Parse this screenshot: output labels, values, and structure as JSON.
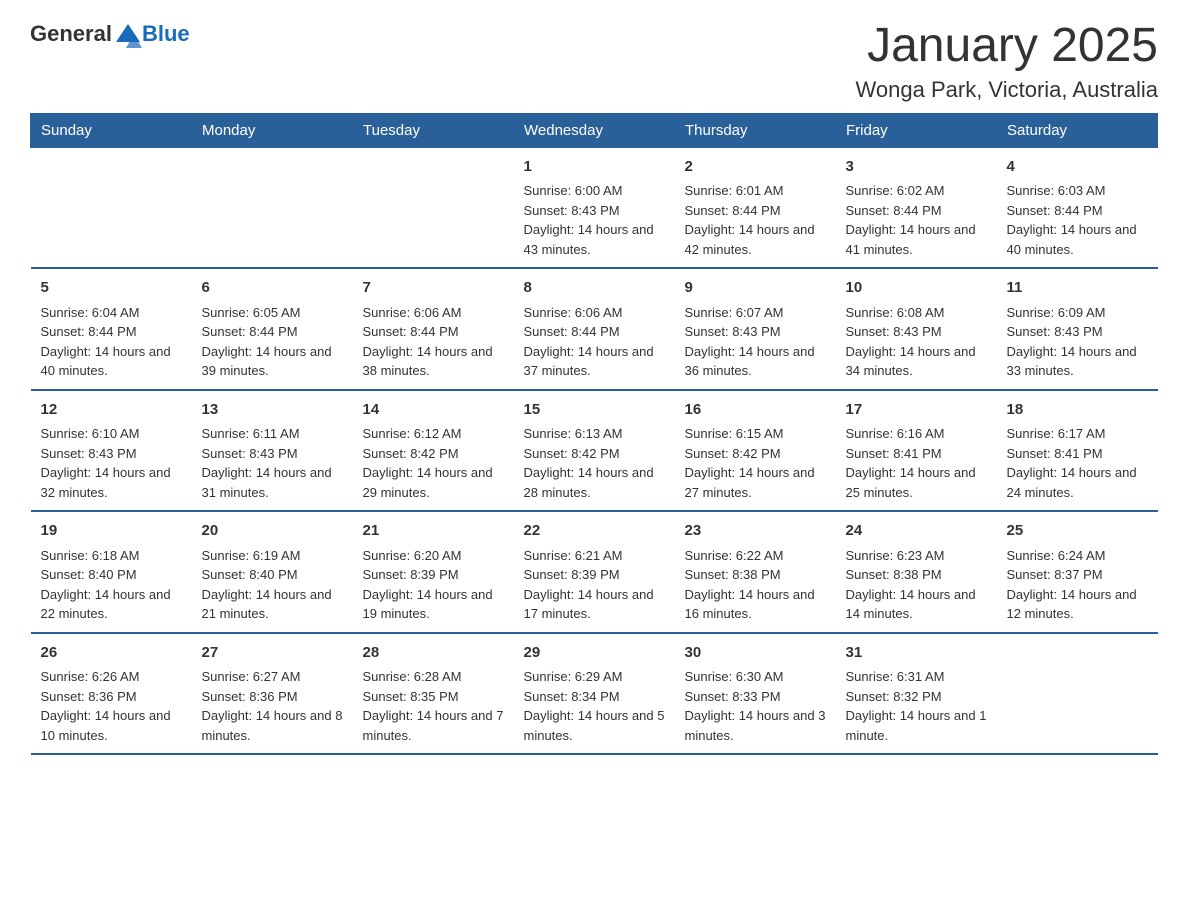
{
  "header": {
    "logo_general": "General",
    "logo_blue": "Blue",
    "month_title": "January 2025",
    "location": "Wonga Park, Victoria, Australia"
  },
  "days_of_week": [
    "Sunday",
    "Monday",
    "Tuesday",
    "Wednesday",
    "Thursday",
    "Friday",
    "Saturday"
  ],
  "weeks": [
    [
      {
        "day": "",
        "info": ""
      },
      {
        "day": "",
        "info": ""
      },
      {
        "day": "",
        "info": ""
      },
      {
        "day": "1",
        "info": "Sunrise: 6:00 AM\nSunset: 8:43 PM\nDaylight: 14 hours and 43 minutes."
      },
      {
        "day": "2",
        "info": "Sunrise: 6:01 AM\nSunset: 8:44 PM\nDaylight: 14 hours and 42 minutes."
      },
      {
        "day": "3",
        "info": "Sunrise: 6:02 AM\nSunset: 8:44 PM\nDaylight: 14 hours and 41 minutes."
      },
      {
        "day": "4",
        "info": "Sunrise: 6:03 AM\nSunset: 8:44 PM\nDaylight: 14 hours and 40 minutes."
      }
    ],
    [
      {
        "day": "5",
        "info": "Sunrise: 6:04 AM\nSunset: 8:44 PM\nDaylight: 14 hours and 40 minutes."
      },
      {
        "day": "6",
        "info": "Sunrise: 6:05 AM\nSunset: 8:44 PM\nDaylight: 14 hours and 39 minutes."
      },
      {
        "day": "7",
        "info": "Sunrise: 6:06 AM\nSunset: 8:44 PM\nDaylight: 14 hours and 38 minutes."
      },
      {
        "day": "8",
        "info": "Sunrise: 6:06 AM\nSunset: 8:44 PM\nDaylight: 14 hours and 37 minutes."
      },
      {
        "day": "9",
        "info": "Sunrise: 6:07 AM\nSunset: 8:43 PM\nDaylight: 14 hours and 36 minutes."
      },
      {
        "day": "10",
        "info": "Sunrise: 6:08 AM\nSunset: 8:43 PM\nDaylight: 14 hours and 34 minutes."
      },
      {
        "day": "11",
        "info": "Sunrise: 6:09 AM\nSunset: 8:43 PM\nDaylight: 14 hours and 33 minutes."
      }
    ],
    [
      {
        "day": "12",
        "info": "Sunrise: 6:10 AM\nSunset: 8:43 PM\nDaylight: 14 hours and 32 minutes."
      },
      {
        "day": "13",
        "info": "Sunrise: 6:11 AM\nSunset: 8:43 PM\nDaylight: 14 hours and 31 minutes."
      },
      {
        "day": "14",
        "info": "Sunrise: 6:12 AM\nSunset: 8:42 PM\nDaylight: 14 hours and 29 minutes."
      },
      {
        "day": "15",
        "info": "Sunrise: 6:13 AM\nSunset: 8:42 PM\nDaylight: 14 hours and 28 minutes."
      },
      {
        "day": "16",
        "info": "Sunrise: 6:15 AM\nSunset: 8:42 PM\nDaylight: 14 hours and 27 minutes."
      },
      {
        "day": "17",
        "info": "Sunrise: 6:16 AM\nSunset: 8:41 PM\nDaylight: 14 hours and 25 minutes."
      },
      {
        "day": "18",
        "info": "Sunrise: 6:17 AM\nSunset: 8:41 PM\nDaylight: 14 hours and 24 minutes."
      }
    ],
    [
      {
        "day": "19",
        "info": "Sunrise: 6:18 AM\nSunset: 8:40 PM\nDaylight: 14 hours and 22 minutes."
      },
      {
        "day": "20",
        "info": "Sunrise: 6:19 AM\nSunset: 8:40 PM\nDaylight: 14 hours and 21 minutes."
      },
      {
        "day": "21",
        "info": "Sunrise: 6:20 AM\nSunset: 8:39 PM\nDaylight: 14 hours and 19 minutes."
      },
      {
        "day": "22",
        "info": "Sunrise: 6:21 AM\nSunset: 8:39 PM\nDaylight: 14 hours and 17 minutes."
      },
      {
        "day": "23",
        "info": "Sunrise: 6:22 AM\nSunset: 8:38 PM\nDaylight: 14 hours and 16 minutes."
      },
      {
        "day": "24",
        "info": "Sunrise: 6:23 AM\nSunset: 8:38 PM\nDaylight: 14 hours and 14 minutes."
      },
      {
        "day": "25",
        "info": "Sunrise: 6:24 AM\nSunset: 8:37 PM\nDaylight: 14 hours and 12 minutes."
      }
    ],
    [
      {
        "day": "26",
        "info": "Sunrise: 6:26 AM\nSunset: 8:36 PM\nDaylight: 14 hours and 10 minutes."
      },
      {
        "day": "27",
        "info": "Sunrise: 6:27 AM\nSunset: 8:36 PM\nDaylight: 14 hours and 8 minutes."
      },
      {
        "day": "28",
        "info": "Sunrise: 6:28 AM\nSunset: 8:35 PM\nDaylight: 14 hours and 7 minutes."
      },
      {
        "day": "29",
        "info": "Sunrise: 6:29 AM\nSunset: 8:34 PM\nDaylight: 14 hours and 5 minutes."
      },
      {
        "day": "30",
        "info": "Sunrise: 6:30 AM\nSunset: 8:33 PM\nDaylight: 14 hours and 3 minutes."
      },
      {
        "day": "31",
        "info": "Sunrise: 6:31 AM\nSunset: 8:32 PM\nDaylight: 14 hours and 1 minute."
      },
      {
        "day": "",
        "info": ""
      }
    ]
  ]
}
